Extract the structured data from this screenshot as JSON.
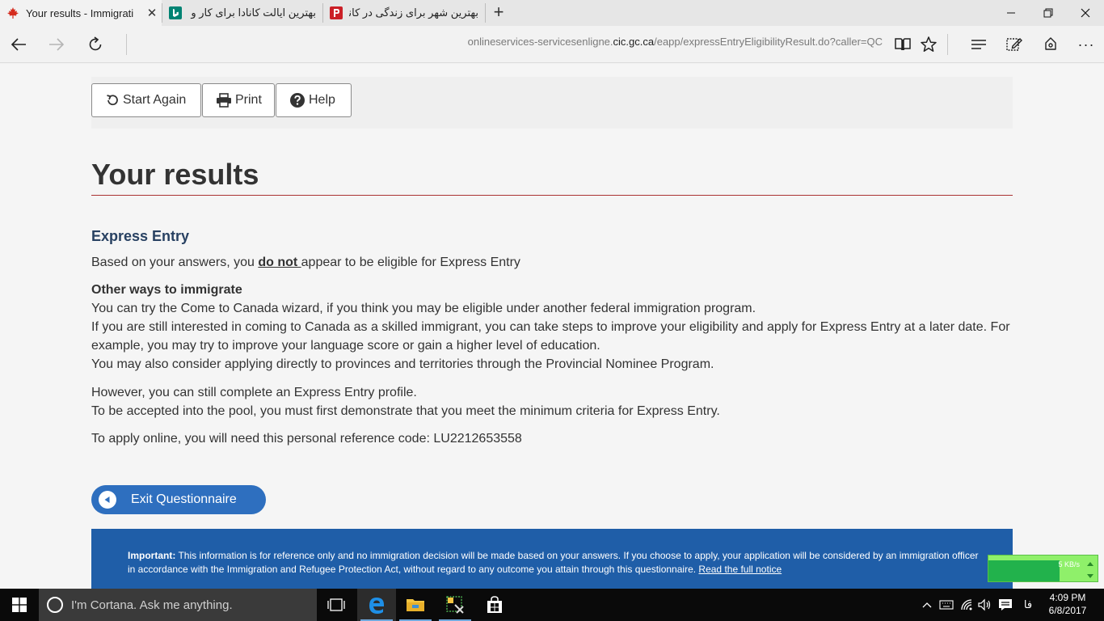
{
  "browser": {
    "tabs": [
      {
        "title": "Your results - Immigrati",
        "close": "✕"
      },
      {
        "title": "بهترین ایالت کانادا برای کار و ز"
      },
      {
        "title": "بهترین شهر برای زندگی در کانا"
      }
    ],
    "new_tab": "+",
    "window": {
      "minimize": "—",
      "restore": "❐",
      "close": "✕"
    },
    "address": {
      "prefix": "onlineservices-servicesenligne.",
      "domain": "cic.gc.ca",
      "path": "/eapp/expressEntryEligibilityResult.do?caller=QC"
    },
    "more": "···"
  },
  "toolbar": {
    "start_again": "Start Again",
    "print": "Print",
    "help": "Help"
  },
  "page": {
    "title": "Your results",
    "section_heading": "Express Entry",
    "result_pre": "Based on your answers, you ",
    "result_emph": "do not ",
    "result_post": "appear to be eligible for Express Entry",
    "other_heading": "Other ways to immigrate",
    "other_1": "You can try the Come to Canada wizard, if you think you may be eligible under another federal immigration program.",
    "other_2": "If you are still interested in coming to Canada as a skilled immigrant, you can take steps to improve your eligibility and apply for Express Entry at a later date. For example, you may try to improve your language score or gain a higher level of education.",
    "other_3": "You may also consider applying directly to provinces and territories through the Provincial Nominee Program.",
    "profile_1": "However, you can still complete an Express Entry profile.",
    "profile_2": "To be accepted into the pool, you must first demonstrate that you meet the minimum criteria for Express Entry.",
    "reference": "To apply online, you will need this personal reference code: LU2212653558",
    "exit_button": "Exit Questionnaire",
    "notice_label": "Important:",
    "notice_text": " This information is for reference only and no immigration decision will be made based on your answers. If you choose to apply, your application will be considered by an immigration officer in accordance with the Immigration and Refugee Protection Act, without regard to any outcome you attain through this questionnaire. ",
    "notice_link": "Read the full notice"
  },
  "netmeter": {
    "speed": "5 KB/s"
  },
  "taskbar": {
    "cortana_placeholder": "I'm Cortana. Ask me anything.",
    "lang": "فا",
    "time": "4:09 PM",
    "date": "6/8/2017"
  },
  "colors": {
    "accent": "#2e6fbf",
    "heading": "#284162",
    "rule": "#aa3333",
    "notice_bg": "#1f5ea8"
  }
}
